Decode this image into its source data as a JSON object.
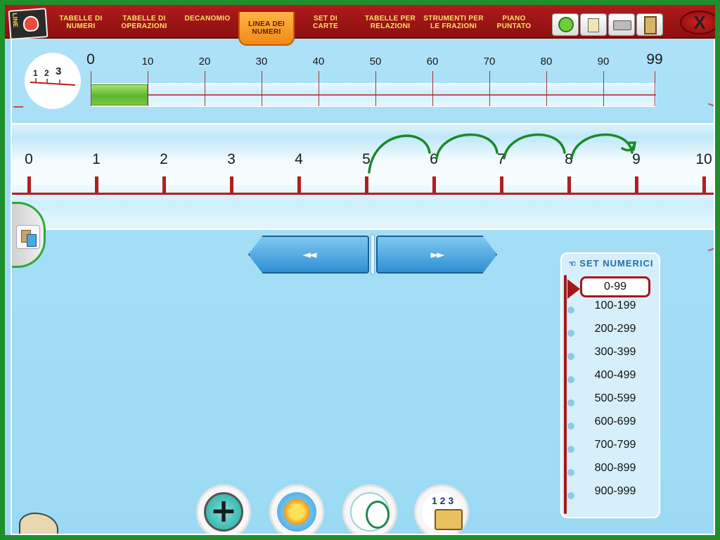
{
  "app": {
    "logo_label": "LINE"
  },
  "nav": {
    "items": [
      {
        "label": "TABELLE DI\nNUMERI"
      },
      {
        "label": "TABELLE DI\nOPERAZIONI"
      },
      {
        "label": "DECANOMIO"
      },
      {
        "label": "LINEA DEI\nNUMERI",
        "active": true
      },
      {
        "label": "SET DI\nCARTE"
      },
      {
        "label": "TABELLE PER\nRELAZIONI"
      },
      {
        "label": "STRUMENTI PER\nLE FRAZIONI"
      },
      {
        "label": "PIANO\nPUNTATO"
      }
    ],
    "close_label": "X"
  },
  "overview_ruler": {
    "icon_digits": [
      "1",
      "2",
      "3"
    ],
    "labels": [
      "0",
      "10",
      "20",
      "30",
      "40",
      "50",
      "60",
      "70",
      "80",
      "90",
      "99"
    ],
    "selection_start": 0,
    "selection_end": 10
  },
  "number_line": {
    "labels": [
      "0",
      "1",
      "2",
      "3",
      "4",
      "5",
      "6",
      "7",
      "8",
      "9",
      "10"
    ],
    "hops": [
      [
        5,
        6
      ],
      [
        6,
        7
      ],
      [
        7,
        8
      ],
      [
        8,
        9
      ]
    ]
  },
  "navigation": {
    "prev_label": "◄◄",
    "next_label": "►►"
  },
  "number_sets": {
    "title": "SET NUMERICI",
    "items": [
      "0-99",
      "100-199",
      "200-299",
      "300-399",
      "400-499",
      "500-599",
      "600-699",
      "700-799",
      "800-899",
      "900-999"
    ],
    "selected_index": 0
  },
  "colors": {
    "frame": "#1f8f2c",
    "topbar": "#b01a1a",
    "accent_red": "#b21e1e",
    "hop_green": "#1a8a2a",
    "active_tab": "#f28a16"
  }
}
